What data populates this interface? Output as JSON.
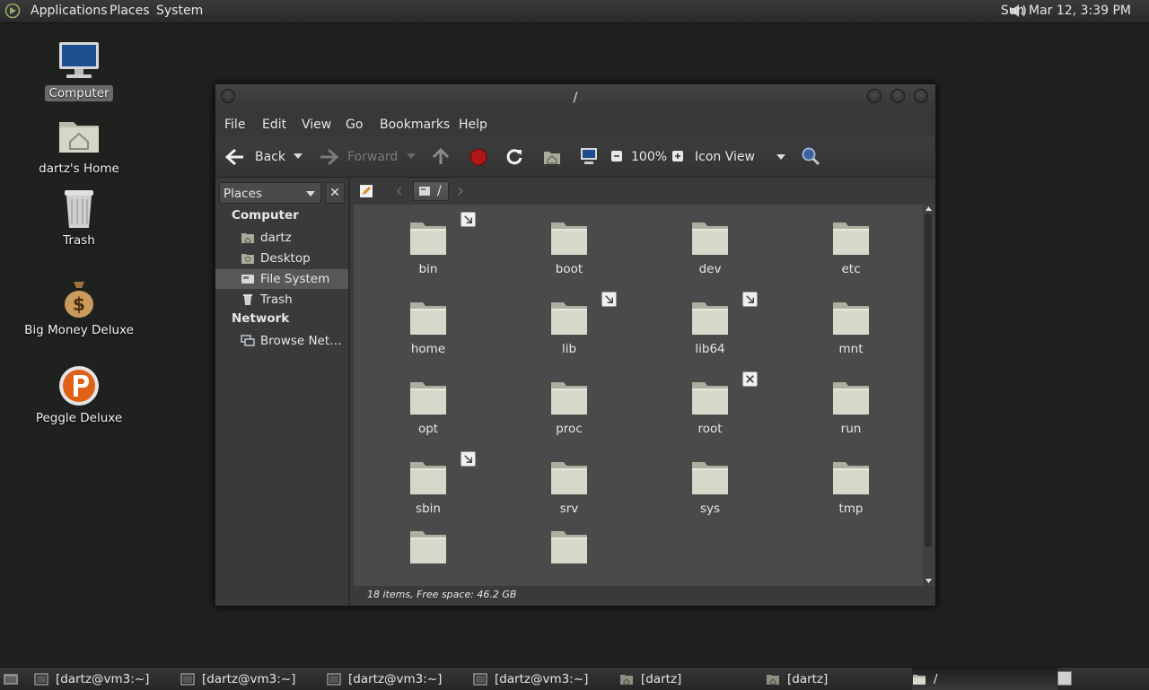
{
  "top_panel": {
    "menus": [
      "Applications",
      "Places",
      "System"
    ],
    "clock": "Sun Mar 12,  3:39 PM"
  },
  "desktop_icons": [
    {
      "label": "Computer",
      "icon": "computer-icon"
    },
    {
      "label": "dartz's Home",
      "icon": "home-folder-icon"
    },
    {
      "label": "Trash",
      "icon": "trash-icon"
    },
    {
      "label": "Big Money Deluxe",
      "icon": "money-bag-icon"
    },
    {
      "label": "Peggle Deluxe",
      "icon": "peggle-icon"
    }
  ],
  "window": {
    "title": "/",
    "menu": [
      "File",
      "Edit",
      "View",
      "Go",
      "Bookmarks",
      "Help"
    ],
    "toolbar": {
      "back": "Back",
      "forward": "Forward",
      "zoom": "100%",
      "view_mode": "Icon View"
    },
    "sidebar": {
      "combo": "Places",
      "close": "✕",
      "sections": [
        {
          "heading": "Computer",
          "items": [
            {
              "label": "dartz",
              "icon": "home-icon"
            },
            {
              "label": "Desktop",
              "icon": "desktop-icon"
            },
            {
              "label": "File System",
              "icon": "drive-icon",
              "selected": true
            },
            {
              "label": "Trash",
              "icon": "trash-icon"
            }
          ]
        },
        {
          "heading": "Network",
          "items": [
            {
              "label": "Browse Net…",
              "icon": "network-icon"
            }
          ]
        }
      ]
    },
    "location": {
      "path": "/"
    },
    "folders": [
      {
        "name": "bin",
        "emblem": "symlink"
      },
      {
        "name": "boot",
        "emblem": ""
      },
      {
        "name": "dev",
        "emblem": ""
      },
      {
        "name": "etc",
        "emblem": ""
      },
      {
        "name": "home",
        "emblem": ""
      },
      {
        "name": "lib",
        "emblem": "symlink"
      },
      {
        "name": "lib64",
        "emblem": "symlink"
      },
      {
        "name": "mnt",
        "emblem": ""
      },
      {
        "name": "opt",
        "emblem": ""
      },
      {
        "name": "proc",
        "emblem": ""
      },
      {
        "name": "root",
        "emblem": "unreadable"
      },
      {
        "name": "run",
        "emblem": ""
      },
      {
        "name": "sbin",
        "emblem": "symlink"
      },
      {
        "name": "srv",
        "emblem": ""
      },
      {
        "name": "sys",
        "emblem": ""
      },
      {
        "name": "tmp",
        "emblem": ""
      },
      {
        "name": "",
        "emblem": ""
      },
      {
        "name": "",
        "emblem": ""
      }
    ],
    "status": "18 items, Free space: 46.2 GB"
  },
  "taskbar": [
    {
      "label": "[dartz@vm3:~]",
      "icon": "terminal-icon"
    },
    {
      "label": "[dartz@vm3:~]",
      "icon": "terminal-icon"
    },
    {
      "label": "[dartz@vm3:~]",
      "icon": "terminal-icon"
    },
    {
      "label": "[dartz@vm3:~]",
      "icon": "terminal-icon"
    },
    {
      "label": "[dartz]",
      "icon": "home-folder-icon"
    },
    {
      "label": "[dartz]",
      "icon": "home-folder-icon"
    },
    {
      "label": "/",
      "icon": "folder-icon",
      "active": true
    }
  ]
}
